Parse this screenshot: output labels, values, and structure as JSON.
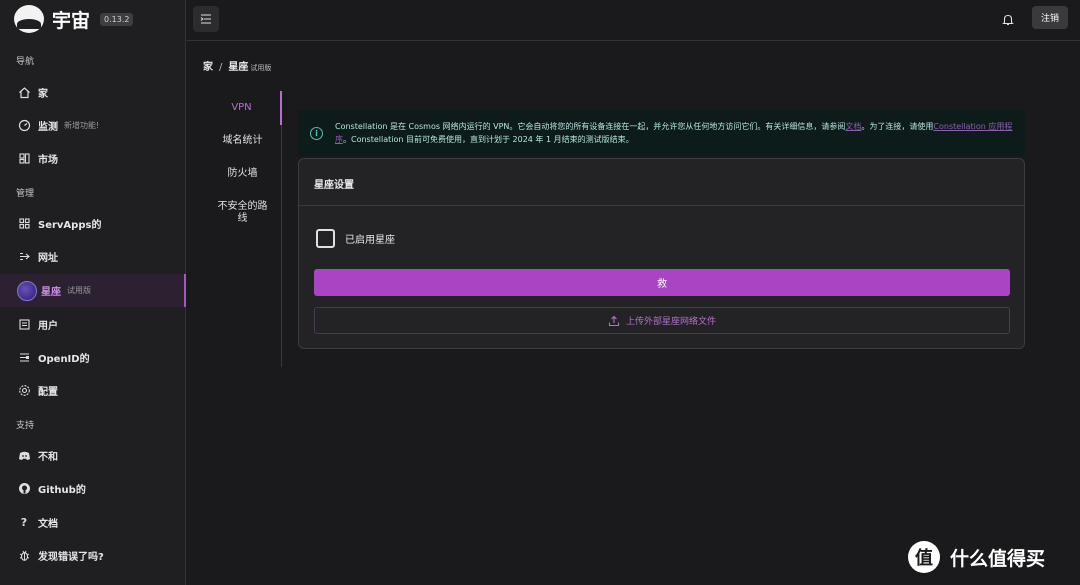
{
  "brand": {
    "name": "宇宙",
    "version": "0.13.2"
  },
  "sidebar": {
    "sections": [
      "导航",
      "管理",
      "支持"
    ],
    "items": [
      {
        "label": "家",
        "icon": "home-icon"
      },
      {
        "label": "监测",
        "tag": "新增功能!",
        "icon": "dashboard-icon"
      },
      {
        "label": "市场",
        "icon": "market-icon"
      },
      {
        "label": "ServApps的",
        "icon": "apps-icon"
      },
      {
        "label": "网址",
        "icon": "url-icon"
      },
      {
        "label": "星座",
        "tag": "试用版",
        "icon": "constellation-icon"
      },
      {
        "label": "用户",
        "icon": "users-icon"
      },
      {
        "label": "OpenID的",
        "icon": "openid-icon"
      },
      {
        "label": "配置",
        "icon": "gear-icon"
      },
      {
        "label": "不和",
        "icon": "discord-icon"
      },
      {
        "label": "Github的",
        "icon": "github-icon"
      },
      {
        "label": "文档",
        "icon": "question-icon"
      },
      {
        "label": "发现错误了吗?",
        "icon": "bug-icon"
      }
    ]
  },
  "topbar": {
    "logout_label": "注销"
  },
  "breadcrumb": {
    "home": "家",
    "separator": "/",
    "current": "星座",
    "current_tag": "试用版"
  },
  "tabs": [
    "VPN",
    "域名统计",
    "防火墙",
    "不安全的路线"
  ],
  "alert": {
    "part1": "Constellation 是在 Cosmos 网络内运行的 VPN。它会自动将您的所有设备连接在一起，并允许您从任何地方访问它们。有关详细信息，请参阅",
    "link1": "文档",
    "part2": "。为了连接，请使用",
    "link2": "Constellation 应用程序",
    "part3": "。Constellation 目前可免费使用，直到计划于 2024 年 1 月结束的测试版结束。"
  },
  "card": {
    "title": "星座设置",
    "checkbox_label": "已启用星座",
    "save_label": "救",
    "upload_label": "上传外部星座网络文件"
  },
  "watermark": {
    "text": "什么值得买",
    "logo": "值"
  },
  "colors": {
    "accent": "#a945c2",
    "active_text": "#b76fd4",
    "alert_bg": "#0d1b1b"
  }
}
